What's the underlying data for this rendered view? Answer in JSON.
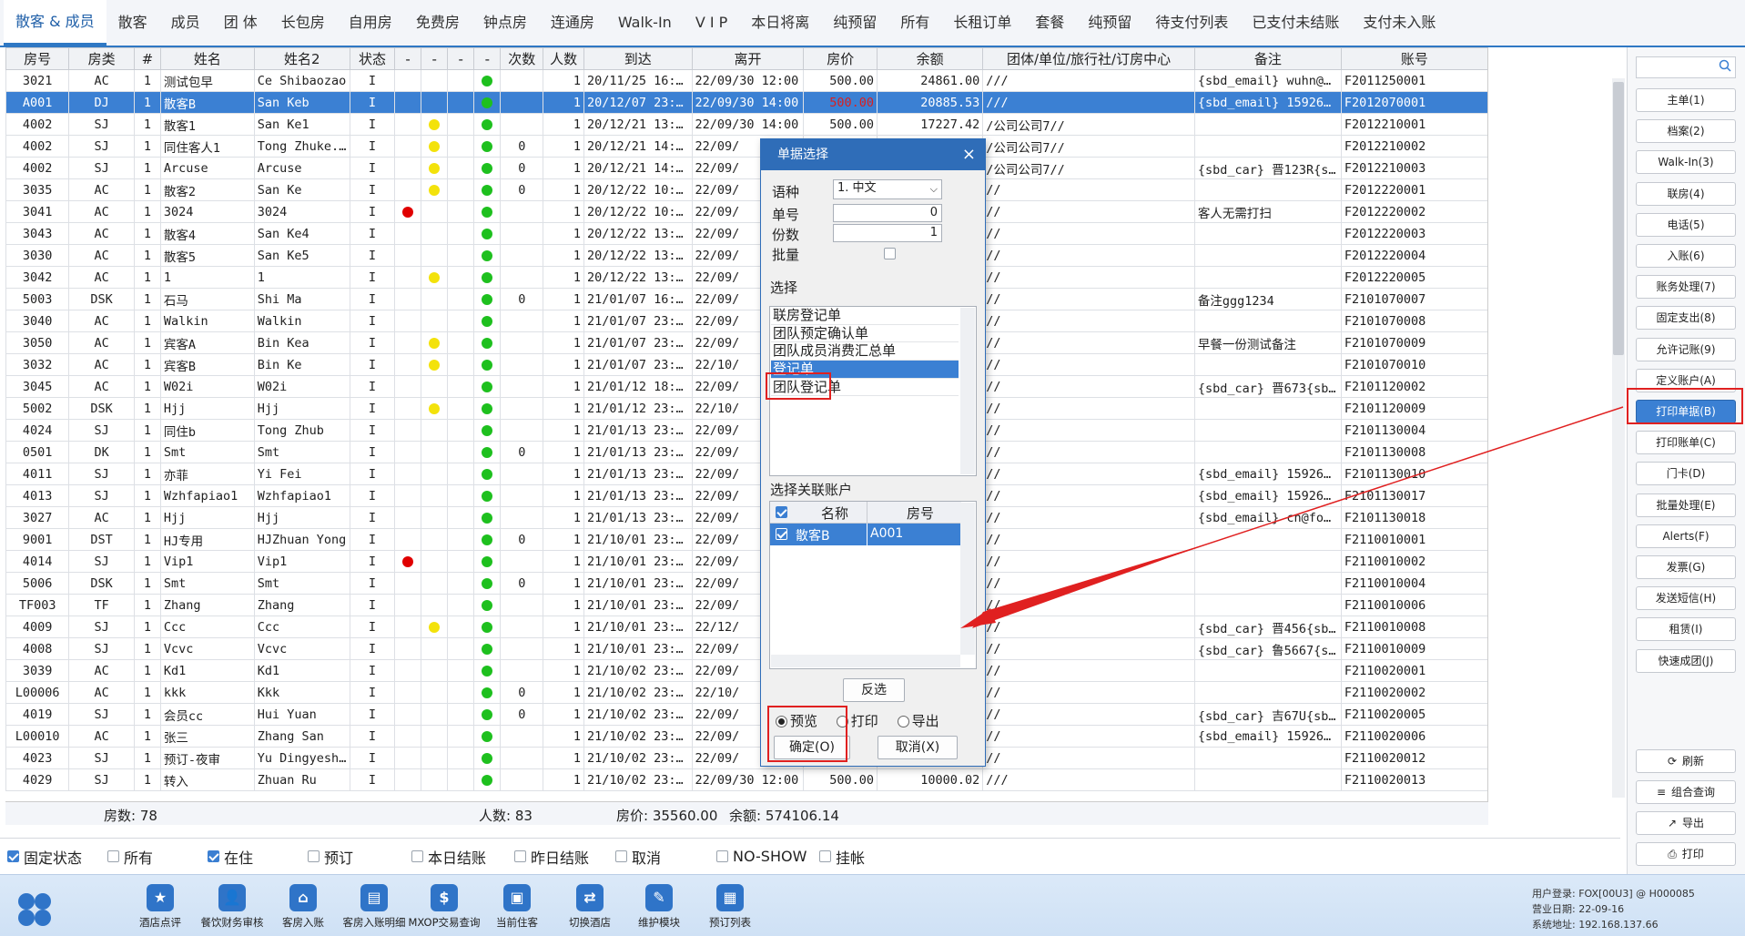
{
  "tabs": [
    "散客 & 成员",
    "散客",
    "成员",
    "团 体",
    "长包房",
    "自用房",
    "免费房",
    "钟点房",
    "连通房",
    "Walk-In",
    "V I P",
    "本日将离",
    "纯预留",
    "所有",
    "长租订单",
    "套餐",
    "纯预留",
    "待支付列表",
    "已支付未结账",
    "支付未入账"
  ],
  "grid": {
    "columns": [
      "房号",
      "房类",
      "#",
      "姓名",
      "姓名2",
      "状态",
      "-",
      "-",
      "-",
      "-",
      "次数",
      "人数",
      "到达",
      "离开",
      "房价",
      "余额",
      "团体/单位/旅行社/订房中心",
      "备注",
      "账号"
    ],
    "rows": [
      {
        "room": "3021",
        "type": "AC",
        "n": "1",
        "name": "测试包早",
        "name2": "Ce Shibaozao",
        "status": "I",
        "d1": "",
        "d2": "",
        "d3": "",
        "d4": "g",
        "times": "",
        "people": "1",
        "arrive": "20/11/25 16:21",
        "leave": "22/09/30 12:00",
        "rate": "500.00",
        "balance": "24861.00",
        "group": "///",
        "note": "{sbd_email} wuhn@f...",
        "acct": "F2011250001"
      },
      {
        "room": "A001",
        "type": "DJ",
        "n": "1",
        "name": "散客B",
        "name2": "San Keb",
        "status": "I",
        "d1": "",
        "d2": "",
        "d3": "",
        "d4": "g",
        "times": "",
        "people": "1",
        "arrive": "20/12/07 23:59",
        "leave": "22/09/30 14:00",
        "rate": "500.00",
        "balance": "20885.53",
        "group": "///",
        "note": "{sbd_email} 159265...",
        "acct": "F2012070001",
        "selected": true
      },
      {
        "room": "4002",
        "type": "SJ",
        "n": "1",
        "name": "散客1",
        "name2": "San Ke1",
        "status": "I",
        "d1": "",
        "d2": "y",
        "d3": "",
        "d4": "g",
        "times": "",
        "people": "1",
        "arrive": "20/12/21 13:58",
        "leave": "22/09/30 14:00",
        "rate": "500.00",
        "balance": "17227.42",
        "group": "/公司公司7//",
        "note": "",
        "acct": "F2012210001"
      },
      {
        "room": "4002",
        "type": "SJ",
        "n": "1",
        "name": "同住客人1",
        "name2": "Tong Zhuke...",
        "status": "I",
        "d1": "",
        "d2": "y",
        "d3": "",
        "d4": "g",
        "times": "0",
        "people": "1",
        "arrive": "20/12/21 14:30",
        "leave": "22/09/",
        "rate": "",
        "balance": "",
        "group": "/公司公司7//",
        "note": "",
        "acct": "F2012210002"
      },
      {
        "room": "4002",
        "type": "SJ",
        "n": "1",
        "name": "Arcuse",
        "name2": "Arcuse",
        "status": "I",
        "d1": "",
        "d2": "y",
        "d3": "",
        "d4": "g",
        "times": "0",
        "people": "1",
        "arrive": "20/12/21 14:30",
        "leave": "22/09/",
        "rate": "",
        "balance": "",
        "group": "/公司公司7//",
        "note": "{sbd_car} 晋123R{s...",
        "acct": "F2012210003"
      },
      {
        "room": "3035",
        "type": "AC",
        "n": "1",
        "name": "散客2",
        "name2": "San Ke",
        "status": "I",
        "d1": "",
        "d2": "y",
        "d3": "",
        "d4": "g",
        "times": "0",
        "people": "1",
        "arrive": "20/12/22 10:16",
        "leave": "22/09/",
        "rate": "",
        "balance": "",
        "group": "//",
        "note": "",
        "acct": "F2012220001"
      },
      {
        "room": "3041",
        "type": "AC",
        "n": "1",
        "name": "3024",
        "name2": "3024",
        "status": "I",
        "d1": "r",
        "d2": "",
        "d3": "",
        "d4": "g",
        "times": "",
        "people": "1",
        "arrive": "20/12/22 10:20",
        "leave": "22/09/",
        "rate": "",
        "balance": "",
        "group": "//",
        "note": "客人无需打扫",
        "acct": "F2012220002"
      },
      {
        "room": "3043",
        "type": "AC",
        "n": "1",
        "name": "散客4",
        "name2": "San Ke4",
        "status": "I",
        "d1": "",
        "d2": "",
        "d3": "",
        "d4": "g",
        "times": "",
        "people": "1",
        "arrive": "20/12/22 13:04",
        "leave": "22/09/",
        "rate": "",
        "balance": "",
        "group": "//",
        "note": "",
        "acct": "F2012220003"
      },
      {
        "room": "3030",
        "type": "AC",
        "n": "1",
        "name": "散客5",
        "name2": "San Ke5",
        "status": "I",
        "d1": "",
        "d2": "",
        "d3": "",
        "d4": "g",
        "times": "",
        "people": "1",
        "arrive": "20/12/22 13:07",
        "leave": "22/09/",
        "rate": "",
        "balance": "",
        "group": "//",
        "note": "",
        "acct": "F2012220004"
      },
      {
        "room": "3042",
        "type": "AC",
        "n": "1",
        "name": "1",
        "name2": "1",
        "status": "I",
        "d1": "",
        "d2": "y",
        "d3": "",
        "d4": "g",
        "times": "",
        "people": "1",
        "arrive": "20/12/22 13:21",
        "leave": "22/09/",
        "rate": "",
        "balance": "",
        "group": "//",
        "note": "",
        "acct": "F2012220005"
      },
      {
        "room": "5003",
        "type": "DSK",
        "n": "1",
        "name": "石马",
        "name2": "Shi Ma",
        "status": "I",
        "d1": "",
        "d2": "",
        "d3": "",
        "d4": "g",
        "times": "0",
        "people": "1",
        "arrive": "21/01/07 16:53",
        "leave": "22/09/",
        "rate": "",
        "balance": "",
        "group": "//",
        "note": "备注ggg1234",
        "acct": "F2101070007"
      },
      {
        "room": "3040",
        "type": "AC",
        "n": "1",
        "name": "Walkin",
        "name2": "Walkin",
        "status": "I",
        "d1": "",
        "d2": "",
        "d3": "",
        "d4": "g",
        "times": "",
        "people": "1",
        "arrive": "21/01/07 23:59",
        "leave": "22/09/",
        "rate": "",
        "balance": "",
        "group": "//",
        "note": "",
        "acct": "F2101070008"
      },
      {
        "room": "3050",
        "type": "AC",
        "n": "1",
        "name": "宾客A",
        "name2": "Bin Kea",
        "status": "I",
        "d1": "",
        "d2": "y",
        "d3": "",
        "d4": "g",
        "times": "",
        "people": "1",
        "arrive": "21/01/07 23:59",
        "leave": "22/09/",
        "rate": "",
        "balance": "",
        "group": "//",
        "note": "早餐一份测试备注",
        "acct": "F2101070009"
      },
      {
        "room": "3032",
        "type": "AC",
        "n": "1",
        "name": "宾客B",
        "name2": "Bin Ke",
        "status": "I",
        "d1": "",
        "d2": "y",
        "d3": "",
        "d4": "g",
        "times": "",
        "people": "1",
        "arrive": "21/01/07 23:59",
        "leave": "22/10/",
        "rate": "",
        "balance": "",
        "group": "//",
        "note": "",
        "acct": "F2101070010"
      },
      {
        "room": "3045",
        "type": "AC",
        "n": "1",
        "name": "W02i",
        "name2": "W02i",
        "status": "I",
        "d1": "",
        "d2": "",
        "d3": "",
        "d4": "g",
        "times": "",
        "people": "1",
        "arrive": "21/01/12 18:00",
        "leave": "22/09/",
        "rate": "",
        "balance": "",
        "group": "//",
        "note": "{sbd_car} 晋673{sb...",
        "acct": "F2101120002"
      },
      {
        "room": "5002",
        "type": "DSK",
        "n": "1",
        "name": "Hjj",
        "name2": "Hjj",
        "status": "I",
        "d1": "",
        "d2": "y",
        "d3": "",
        "d4": "g",
        "times": "",
        "people": "1",
        "arrive": "21/01/12 23:59",
        "leave": "22/10/",
        "rate": "",
        "balance": "",
        "group": "//",
        "note": "",
        "acct": "F2101120009"
      },
      {
        "room": "4024",
        "type": "SJ",
        "n": "1",
        "name": "同住b",
        "name2": "Tong Zhub",
        "status": "I",
        "d1": "",
        "d2": "",
        "d3": "",
        "d4": "g",
        "times": "",
        "people": "1",
        "arrive": "21/01/13 23:59",
        "leave": "22/09/",
        "rate": "",
        "balance": "",
        "group": "//",
        "note": "",
        "acct": "F2101130004"
      },
      {
        "room": "0501",
        "type": "DK",
        "n": "1",
        "name": "Smt",
        "name2": "Smt",
        "status": "I",
        "d1": "",
        "d2": "",
        "d3": "",
        "d4": "g",
        "times": "0",
        "people": "1",
        "arrive": "21/01/13 23:59",
        "leave": "22/09/",
        "rate": "",
        "balance": "",
        "group": "//",
        "note": "",
        "acct": "F2101130008"
      },
      {
        "room": "4011",
        "type": "SJ",
        "n": "1",
        "name": "亦菲",
        "name2": "Yi Fei",
        "status": "I",
        "d1": "",
        "d2": "",
        "d3": "",
        "d4": "g",
        "times": "",
        "people": "1",
        "arrive": "21/01/13 23:59",
        "leave": "22/09/",
        "rate": "",
        "balance": "",
        "group": "//",
        "note": "{sbd_email} 159265...",
        "acct": "F2101130010"
      },
      {
        "room": "4013",
        "type": "SJ",
        "n": "1",
        "name": "Wzhfapiao1",
        "name2": "Wzhfapiao1",
        "status": "I",
        "d1": "",
        "d2": "",
        "d3": "",
        "d4": "g",
        "times": "",
        "people": "1",
        "arrive": "21/01/13 23:59",
        "leave": "22/09/",
        "rate": "",
        "balance": "",
        "group": "//",
        "note": "{sbd_email} 159265...",
        "acct": "F2101130017"
      },
      {
        "room": "3027",
        "type": "AC",
        "n": "1",
        "name": "Hjj",
        "name2": "Hjj",
        "status": "I",
        "d1": "",
        "d2": "",
        "d3": "",
        "d4": "g",
        "times": "",
        "people": "1",
        "arrive": "21/01/13 23:59",
        "leave": "22/09/",
        "rate": "",
        "balance": "",
        "group": "//",
        "note": "{sbd_email} cn@fox...",
        "acct": "F2101130018"
      },
      {
        "room": "9001",
        "type": "DST",
        "n": "1",
        "name": "HJ专用",
        "name2": "HJZhuan Yong",
        "status": "I",
        "d1": "",
        "d2": "",
        "d3": "",
        "d4": "g",
        "times": "0",
        "people": "1",
        "arrive": "21/10/01 23:59",
        "leave": "22/09/",
        "rate": "",
        "balance": "",
        "group": "//",
        "note": "",
        "acct": "F2110010001"
      },
      {
        "room": "4014",
        "type": "SJ",
        "n": "1",
        "name": "Vip1",
        "name2": "Vip1",
        "status": "I",
        "d1": "r",
        "d2": "",
        "d3": "",
        "d4": "g",
        "times": "",
        "people": "1",
        "arrive": "21/10/01 23:59",
        "leave": "22/09/",
        "rate": "",
        "balance": "",
        "group": "//",
        "note": "",
        "acct": "F2110010002"
      },
      {
        "room": "5006",
        "type": "DSK",
        "n": "1",
        "name": "Smt",
        "name2": "Smt",
        "status": "I",
        "d1": "",
        "d2": "",
        "d3": "",
        "d4": "g",
        "times": "0",
        "people": "1",
        "arrive": "21/10/01 23:59",
        "leave": "22/09/",
        "rate": "",
        "balance": "",
        "group": "//",
        "note": "",
        "acct": "F2110010004"
      },
      {
        "room": "TF003",
        "type": "TF",
        "n": "1",
        "name": "Zhang",
        "name2": "Zhang",
        "status": "I",
        "d1": "",
        "d2": "",
        "d3": "",
        "d4": "g",
        "times": "",
        "people": "1",
        "arrive": "21/10/01 23:59",
        "leave": "22/09/",
        "rate": "",
        "balance": "",
        "group": "//",
        "note": "",
        "acct": "F2110010006"
      },
      {
        "room": "4009",
        "type": "SJ",
        "n": "1",
        "name": "Ccc",
        "name2": "Ccc",
        "status": "I",
        "d1": "",
        "d2": "y",
        "d3": "",
        "d4": "g",
        "times": "",
        "people": "1",
        "arrive": "21/10/01 23:59",
        "leave": "22/12/",
        "rate": "",
        "balance": "",
        "group": "//",
        "note": "{sbd_car} 晋456{sb...",
        "acct": "F2110010008"
      },
      {
        "room": "4008",
        "type": "SJ",
        "n": "1",
        "name": "Vcvc",
        "name2": "Vcvc",
        "status": "I",
        "d1": "",
        "d2": "",
        "d3": "",
        "d4": "g",
        "times": "",
        "people": "1",
        "arrive": "21/10/01 23:59",
        "leave": "22/09/",
        "rate": "",
        "balance": "",
        "group": "//",
        "note": "{sbd_car} 鲁5667{s...",
        "acct": "F2110010009"
      },
      {
        "room": "3039",
        "type": "AC",
        "n": "1",
        "name": "Kd1",
        "name2": "Kd1",
        "status": "I",
        "d1": "",
        "d2": "",
        "d3": "",
        "d4": "g",
        "times": "",
        "people": "1",
        "arrive": "21/10/02 23:59",
        "leave": "22/09/",
        "rate": "",
        "balance": "",
        "group": "//",
        "note": "",
        "acct": "F2110020001"
      },
      {
        "room": "L00006",
        "type": "AC",
        "n": "1",
        "name": "kkk",
        "name2": "Kkk",
        "status": "I",
        "d1": "",
        "d2": "",
        "d3": "",
        "d4": "g",
        "times": "0",
        "people": "1",
        "arrive": "21/10/02 23:59",
        "leave": "22/10/",
        "rate": "",
        "balance": "",
        "group": "//",
        "note": "",
        "acct": "F2110020002"
      },
      {
        "room": "4019",
        "type": "SJ",
        "n": "1",
        "name": "会员cc",
        "name2": "Hui Yuan",
        "status": "I",
        "d1": "",
        "d2": "",
        "d3": "",
        "d4": "g",
        "times": "0",
        "people": "1",
        "arrive": "21/10/02 23:59",
        "leave": "22/09/",
        "rate": "",
        "balance": "",
        "group": "//",
        "note": "{sbd_car} 吉67U{sb...",
        "acct": "F2110020005"
      },
      {
        "room": "L00010",
        "type": "AC",
        "n": "1",
        "name": "张三",
        "name2": "Zhang San",
        "status": "I",
        "d1": "",
        "d2": "",
        "d3": "",
        "d4": "g",
        "times": "",
        "people": "1",
        "arrive": "21/10/02 23:59",
        "leave": "22/09/",
        "rate": "",
        "balance": "",
        "group": "//",
        "note": "{sbd_email} 159265...",
        "acct": "F2110020006"
      },
      {
        "room": "4023",
        "type": "SJ",
        "n": "1",
        "name": "预订-夜审",
        "name2": "Yu Dingyeshen",
        "status": "I",
        "d1": "",
        "d2": "",
        "d3": "",
        "d4": "g",
        "times": "",
        "people": "1",
        "arrive": "21/10/02 23:59",
        "leave": "22/09/",
        "rate": "",
        "balance": "",
        "group": "//",
        "note": "",
        "acct": "F2110020012"
      },
      {
        "room": "4029",
        "type": "SJ",
        "n": "1",
        "name": "转入",
        "name2": "Zhuan Ru",
        "status": "I",
        "d1": "",
        "d2": "",
        "d3": "",
        "d4": "g",
        "times": "",
        "people": "1",
        "arrive": "21/10/02 23:59",
        "leave": "22/09/30 12:00",
        "rate": "500.00",
        "balance": "10000.02",
        "group": "///",
        "note": "",
        "acct": "F2110020013"
      }
    ]
  },
  "summary": {
    "rooms": "房数: 78",
    "people": "人数: 83",
    "rate": "房价: 35560.00",
    "balance": "余额: 574106.14"
  },
  "filters": [
    {
      "label": "固定状态",
      "checked": true
    },
    {
      "label": "所有",
      "checked": false
    },
    {
      "label": "在住",
      "checked": true
    },
    {
      "label": "预订",
      "checked": false
    },
    {
      "label": "本日结账",
      "checked": false
    },
    {
      "label": "昨日结账",
      "checked": false
    },
    {
      "label": "取消",
      "checked": false
    },
    {
      "label": "NO-SHOW",
      "checked": false
    },
    {
      "label": "挂帐",
      "checked": false
    }
  ],
  "side_buttons": [
    "主单(1)",
    "档案(2)",
    "Walk-In(3)",
    "联房(4)",
    "电话(5)",
    "入账(6)",
    "账务处理(7)",
    "固定支出(8)",
    "允许记账(9)",
    "定义账户(A)",
    "打印单据(B)",
    "打印账单(C)",
    "门卡(D)",
    "批量处理(E)",
    "Alerts(F)",
    "发票(G)",
    "发送短信(H)",
    "租赁(I)",
    "快速成团(J)"
  ],
  "side_bottom": [
    {
      "icon": "⟳",
      "label": "刷新"
    },
    {
      "icon": "≡",
      "label": "组合查询"
    },
    {
      "icon": "↗",
      "label": "导出"
    },
    {
      "icon": "⎙",
      "label": "打印"
    }
  ],
  "toolbar": [
    "酒店点评",
    "餐饮财务审核",
    "客房入账",
    "客房入账明细",
    "MXOP交易查询",
    "当前住客",
    "切换酒店",
    "维护模块",
    "预订列表"
  ],
  "toolbar_glyphs": [
    "★",
    "👤",
    "⌂",
    "▤",
    "$",
    "▣",
    "⇄",
    "✎",
    "▦"
  ],
  "sysinfo": {
    "login": "用户登录: FOX[00U3] @ H000085",
    "date": "营业日期: 22-09-16",
    "address": "系统地址: 192.168.137.66"
  },
  "dialog": {
    "title": "单据选择",
    "close": "×",
    "language_label": "语种",
    "language_value": "1. 中文",
    "number_label": "单号",
    "number_value": "0",
    "copies_label": "份数",
    "copies_value": "1",
    "batch_label": "批量",
    "select_label": "选择",
    "documents": [
      "联房登记单",
      "团队预定确认单",
      "团队成员消费汇总单",
      "登记单",
      "团队登记单"
    ],
    "selected_document_index": 3,
    "accounts_label": "选择关联账户",
    "acct_col_name": "名称",
    "acct_col_room": "房号",
    "acct_row_name": "散客B",
    "acct_row_room": "A001",
    "invert_button": "反选",
    "mode_preview": "预览",
    "mode_print": "打印",
    "mode_export": "导出",
    "ok_button": "确定(O)",
    "cancel_button": "取消(X)"
  },
  "colors": {
    "accent": "#3b80d3",
    "highlight": "#e02020",
    "titlebar": "#2f6db8"
  }
}
